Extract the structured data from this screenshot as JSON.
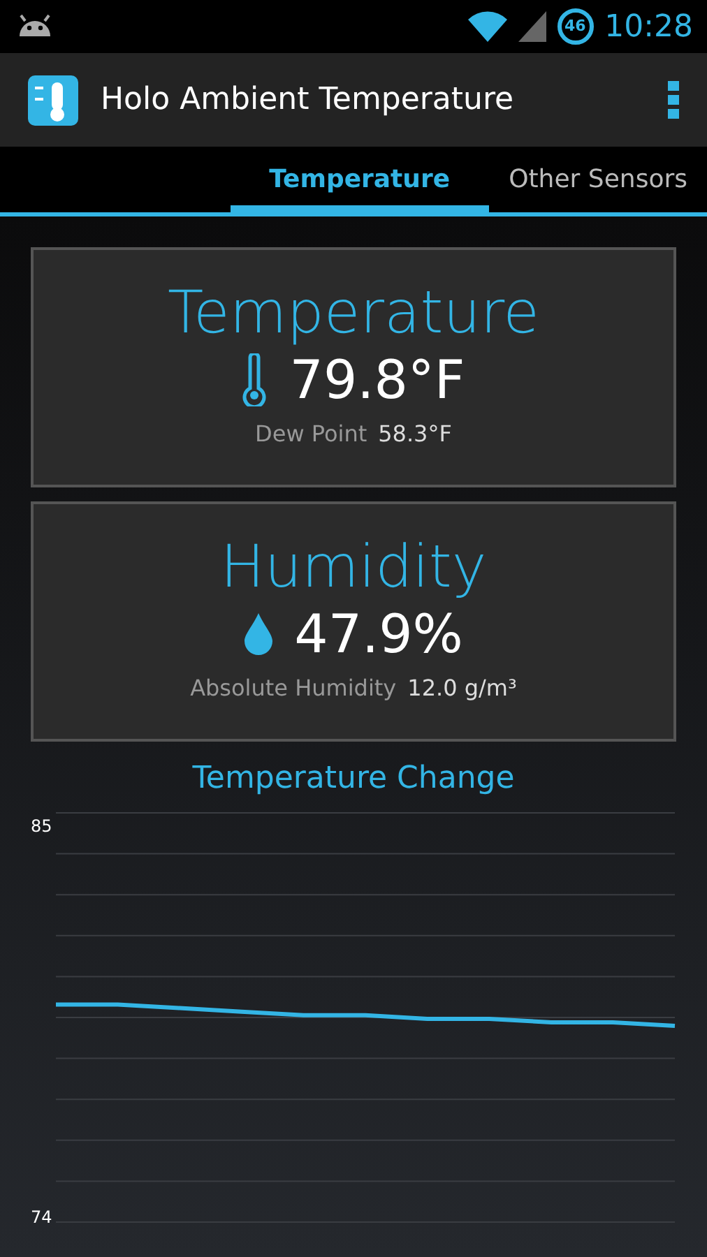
{
  "status_bar": {
    "notification_count": "46",
    "time": "10:28"
  },
  "action_bar": {
    "title": "Holo Ambient Temperature"
  },
  "tabs": [
    {
      "label": "Temperature",
      "selected": true
    },
    {
      "label": "Other Sensors",
      "selected": false
    }
  ],
  "cards": [
    {
      "kind": "temperature",
      "title": "Temperature",
      "value": "79.8°F",
      "detail_label": "Dew Point",
      "detail_value": "58.3°F"
    },
    {
      "kind": "humidity",
      "title": "Humidity",
      "value": "47.9%",
      "detail_label": "Absolute Humidity",
      "detail_value": "12.0 g/m³"
    }
  ],
  "chart": {
    "title": "Temperature Change",
    "chart_data": {
      "type": "line",
      "ylim": [
        74,
        85
      ],
      "yticks": [
        74,
        85
      ],
      "series": [
        {
          "color": "#33b5e5",
          "values": [
            80.0,
            80.0,
            79.9,
            79.8,
            79.7,
            79.7,
            79.6,
            79.6,
            79.5,
            79.5,
            79.4
          ]
        }
      ]
    }
  }
}
